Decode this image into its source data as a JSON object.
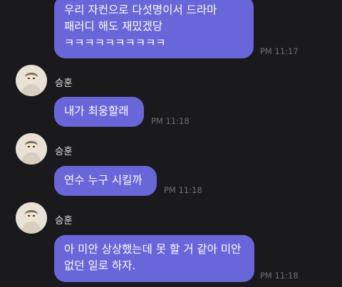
{
  "messages": [
    {
      "text": "우리 자컨으로 다섯명이서 드라마 패러디 해도 재밌겠당 ㅋㅋㅋㅋㅋㅋㅋㅋㅋㅋ",
      "time": "PM 11:17"
    },
    {
      "sender": "승훈",
      "text": "내가 최웅할래",
      "time": "PM 11:18",
      "avatar_icon": "profile-photo"
    },
    {
      "sender": "승훈",
      "text": "연수 누구 시킬까",
      "time": "PM 11:18",
      "avatar_icon": "profile-photo"
    },
    {
      "sender": "승훈",
      "text": "아 미안 상상했는데 못 할 거 같아 미안 없던 일로 하자.",
      "time": "PM 11:18",
      "avatar_icon": "profile-photo"
    }
  ],
  "colors": {
    "background": "#1a1a1c",
    "bubble": "#6866d9",
    "text": "#ffffff",
    "time": "#6f6f74",
    "name": "#e4e4e6"
  }
}
